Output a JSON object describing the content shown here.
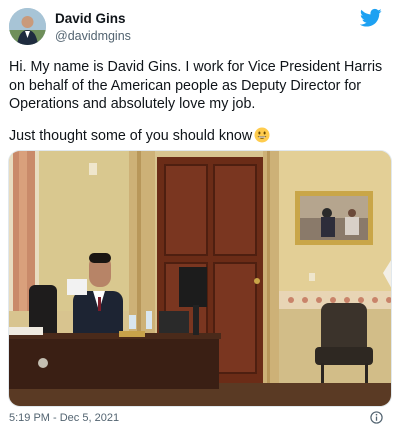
{
  "author": {
    "name": "David Gins",
    "handle": "@davidmgins"
  },
  "tweet": {
    "text_line1": "Hi. My name is David Gins. I work for Vice President Harris on behalf of the American people as Deputy Director for Operations and absolutely love my job.",
    "text_line2": "Just thought some of you should know",
    "emoji": "grinning-face-emoji"
  },
  "footer": {
    "timestamp": "5:19 PM - Dec 5, 2021"
  },
  "colors": {
    "twitter_blue": "#1da1f2",
    "secondary_text": "#536471"
  },
  "icons": {
    "brand": "twitter-bird-icon",
    "info": "info-icon"
  }
}
